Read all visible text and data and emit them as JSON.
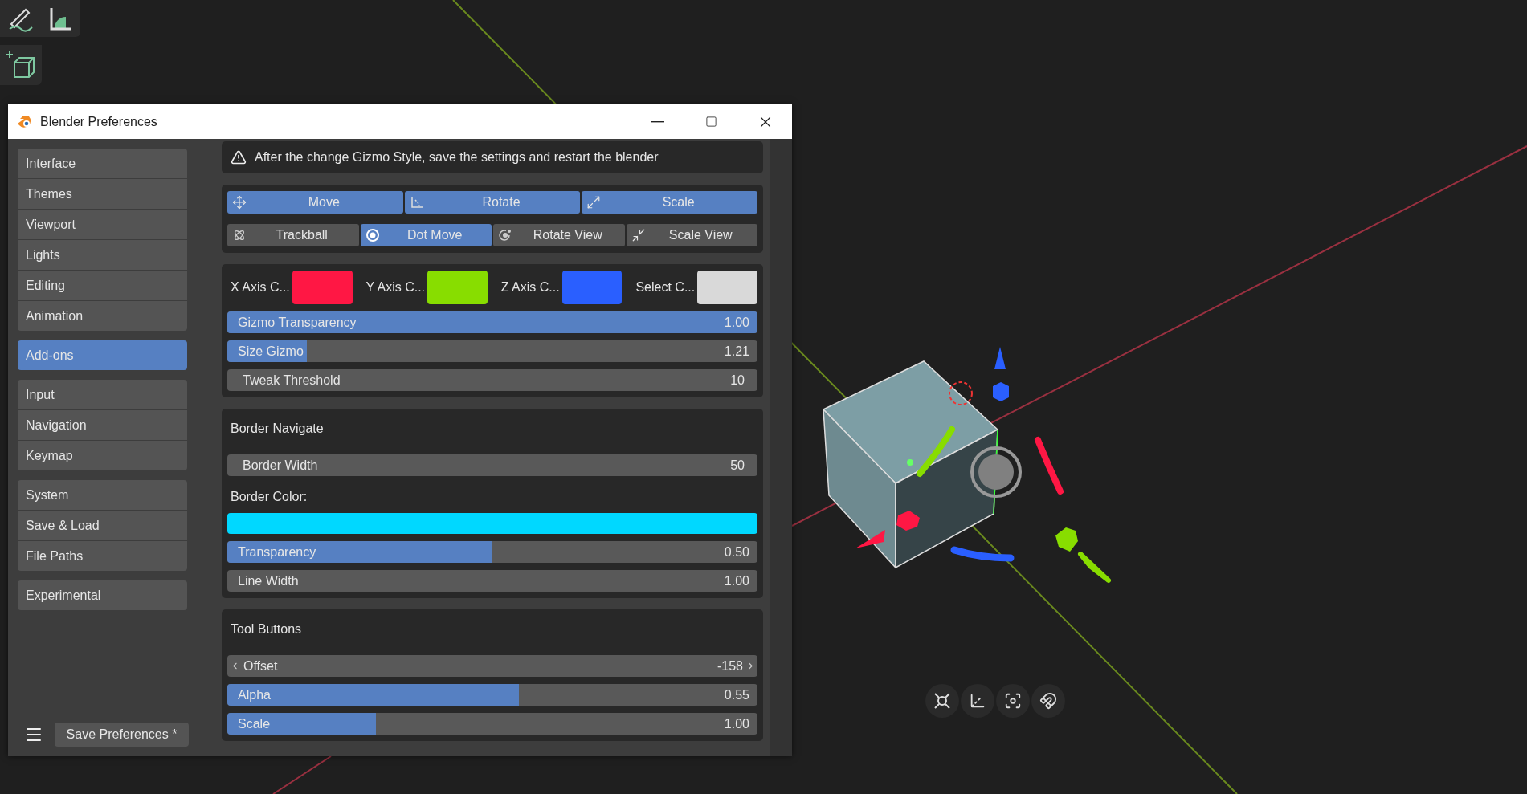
{
  "window": {
    "title": "Blender Preferences"
  },
  "sidebar": {
    "groups": [
      [
        {
          "label": "Interface",
          "selected": false
        },
        {
          "label": "Themes",
          "selected": false
        },
        {
          "label": "Viewport",
          "selected": false
        },
        {
          "label": "Lights",
          "selected": false
        },
        {
          "label": "Editing",
          "selected": false
        },
        {
          "label": "Animation",
          "selected": false
        }
      ],
      [
        {
          "label": "Add-ons",
          "selected": true
        }
      ],
      [
        {
          "label": "Input",
          "selected": false
        },
        {
          "label": "Navigation",
          "selected": false
        },
        {
          "label": "Keymap",
          "selected": false
        }
      ],
      [
        {
          "label": "System",
          "selected": false
        },
        {
          "label": "Save & Load",
          "selected": false
        },
        {
          "label": "File Paths",
          "selected": false
        }
      ],
      [
        {
          "label": "Experimental",
          "selected": false
        }
      ]
    ],
    "save_button": "Save Preferences *"
  },
  "notice": "After the change Gizmo Style, save the settings and restart the blender",
  "gizmo_style": {
    "transform_types": [
      {
        "label": "Move",
        "kind": "move",
        "selected": true
      },
      {
        "label": "Rotate",
        "kind": "rotate",
        "selected": true
      },
      {
        "label": "Scale",
        "kind": "scale",
        "selected": true
      }
    ],
    "view_types": [
      {
        "label": "Trackball",
        "kind": "trackball",
        "selected": false
      },
      {
        "label": "Dot Move",
        "kind": "dot",
        "selected": true
      },
      {
        "label": "Rotate View",
        "kind": "orbit",
        "selected": false
      },
      {
        "label": "Scale View",
        "kind": "shrink",
        "selected": false
      }
    ]
  },
  "axis_colors": [
    {
      "label": "X Axis C...",
      "color": "#ff1744"
    },
    {
      "label": "Y Axis C...",
      "color": "#88dd00"
    },
    {
      "label": "Z Axis C...",
      "color": "#2a5fff"
    },
    {
      "label": "Select C...",
      "color": "#d9d9d9"
    }
  ],
  "gizmo_settings": [
    {
      "kind": "slider",
      "label": "Gizmo Transparency",
      "value": "1.00",
      "level": 1
    },
    {
      "kind": "slider",
      "label": "Size Gizmo",
      "value": "1.21",
      "level": 0.15
    },
    {
      "kind": "number",
      "label": "Tweak Threshold",
      "value": "10"
    }
  ],
  "border_navigate": {
    "heading": "Border Navigate",
    "border_width": {
      "kind": "number",
      "label": "Border Width",
      "value": "50"
    },
    "color_label": "Border Color:",
    "color": "#00d8ff",
    "settings": [
      {
        "kind": "slider",
        "label": "Transparency",
        "value": "0.50",
        "level": 0.5
      },
      {
        "kind": "field",
        "label": "Line Width",
        "value": "1.00"
      }
    ]
  },
  "tool_buttons": {
    "heading": "Tool Buttons",
    "settings": [
      {
        "kind": "stepper",
        "label": "Offset",
        "value": "-158"
      },
      {
        "kind": "slider",
        "label": "Alpha",
        "value": "0.55",
        "level": 0.55
      },
      {
        "kind": "slider",
        "label": "Scale",
        "value": "1.00",
        "level": 0.28
      }
    ]
  }
}
